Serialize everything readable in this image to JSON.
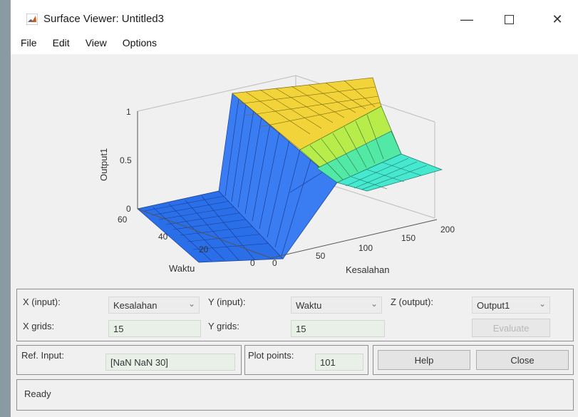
{
  "window": {
    "title": "Surface Viewer: Untitled3"
  },
  "menu": [
    "File",
    "Edit",
    "View",
    "Options"
  ],
  "plot": {
    "zlabel": "Output1",
    "ylabel": "Waktu",
    "xlabel": "Kesalahan",
    "z_ticks": [
      "0",
      "0.5",
      "1"
    ],
    "y_ticks": [
      "0",
      "20",
      "40",
      "60"
    ],
    "x_ticks": [
      "0",
      "50",
      "100",
      "150",
      "200"
    ]
  },
  "controls": {
    "x_input_label": "X (input):",
    "x_input_value": "Kesalahan",
    "y_input_label": "Y (input):",
    "y_input_value": "Waktu",
    "z_output_label": "Z (output):",
    "z_output_value": "Output1",
    "x_grids_label": "X grids:",
    "x_grids_value": "15",
    "y_grids_label": "Y grids:",
    "y_grids_value": "15",
    "evaluate_label": "Evaluate",
    "ref_input_label": "Ref. Input:",
    "ref_input_value": "[NaN NaN 30]",
    "plot_points_label": "Plot points:",
    "plot_points_value": "101",
    "help_label": "Help",
    "close_label": "Close"
  },
  "status": {
    "text": "Ready"
  },
  "colors": {
    "dropdown_arrow": "#777777",
    "field_bg": "#e8f0e8"
  },
  "icons": {
    "dropdown": "chevron-down-icon",
    "app": "matlab-icon"
  }
}
